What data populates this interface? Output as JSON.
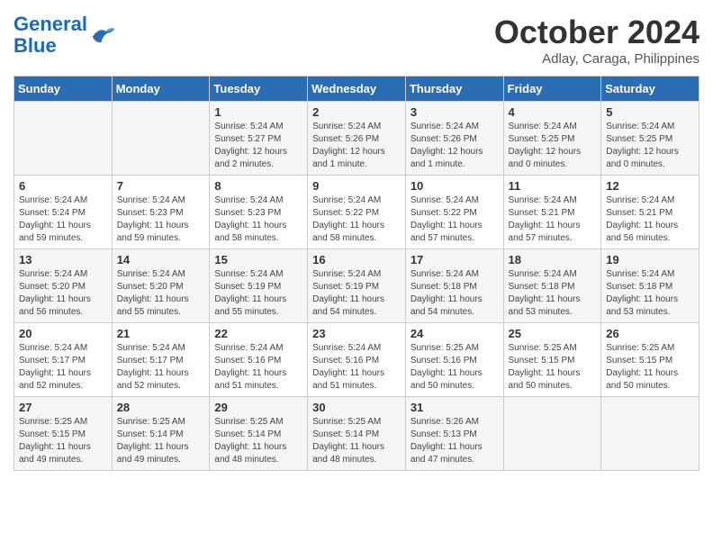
{
  "header": {
    "logo_line1": "General",
    "logo_line2": "Blue",
    "month": "October 2024",
    "location": "Adlay, Caraga, Philippines"
  },
  "days_of_week": [
    "Sunday",
    "Monday",
    "Tuesday",
    "Wednesday",
    "Thursday",
    "Friday",
    "Saturday"
  ],
  "weeks": [
    [
      {
        "day": "",
        "info": ""
      },
      {
        "day": "",
        "info": ""
      },
      {
        "day": "1",
        "info": "Sunrise: 5:24 AM\nSunset: 5:27 PM\nDaylight: 12 hours\nand 2 minutes."
      },
      {
        "day": "2",
        "info": "Sunrise: 5:24 AM\nSunset: 5:26 PM\nDaylight: 12 hours\nand 1 minute."
      },
      {
        "day": "3",
        "info": "Sunrise: 5:24 AM\nSunset: 5:26 PM\nDaylight: 12 hours\nand 1 minute."
      },
      {
        "day": "4",
        "info": "Sunrise: 5:24 AM\nSunset: 5:25 PM\nDaylight: 12 hours\nand 0 minutes."
      },
      {
        "day": "5",
        "info": "Sunrise: 5:24 AM\nSunset: 5:25 PM\nDaylight: 12 hours\nand 0 minutes."
      }
    ],
    [
      {
        "day": "6",
        "info": "Sunrise: 5:24 AM\nSunset: 5:24 PM\nDaylight: 11 hours\nand 59 minutes."
      },
      {
        "day": "7",
        "info": "Sunrise: 5:24 AM\nSunset: 5:23 PM\nDaylight: 11 hours\nand 59 minutes."
      },
      {
        "day": "8",
        "info": "Sunrise: 5:24 AM\nSunset: 5:23 PM\nDaylight: 11 hours\nand 58 minutes."
      },
      {
        "day": "9",
        "info": "Sunrise: 5:24 AM\nSunset: 5:22 PM\nDaylight: 11 hours\nand 58 minutes."
      },
      {
        "day": "10",
        "info": "Sunrise: 5:24 AM\nSunset: 5:22 PM\nDaylight: 11 hours\nand 57 minutes."
      },
      {
        "day": "11",
        "info": "Sunrise: 5:24 AM\nSunset: 5:21 PM\nDaylight: 11 hours\nand 57 minutes."
      },
      {
        "day": "12",
        "info": "Sunrise: 5:24 AM\nSunset: 5:21 PM\nDaylight: 11 hours\nand 56 minutes."
      }
    ],
    [
      {
        "day": "13",
        "info": "Sunrise: 5:24 AM\nSunset: 5:20 PM\nDaylight: 11 hours\nand 56 minutes."
      },
      {
        "day": "14",
        "info": "Sunrise: 5:24 AM\nSunset: 5:20 PM\nDaylight: 11 hours\nand 55 minutes."
      },
      {
        "day": "15",
        "info": "Sunrise: 5:24 AM\nSunset: 5:19 PM\nDaylight: 11 hours\nand 55 minutes."
      },
      {
        "day": "16",
        "info": "Sunrise: 5:24 AM\nSunset: 5:19 PM\nDaylight: 11 hours\nand 54 minutes."
      },
      {
        "day": "17",
        "info": "Sunrise: 5:24 AM\nSunset: 5:18 PM\nDaylight: 11 hours\nand 54 minutes."
      },
      {
        "day": "18",
        "info": "Sunrise: 5:24 AM\nSunset: 5:18 PM\nDaylight: 11 hours\nand 53 minutes."
      },
      {
        "day": "19",
        "info": "Sunrise: 5:24 AM\nSunset: 5:18 PM\nDaylight: 11 hours\nand 53 minutes."
      }
    ],
    [
      {
        "day": "20",
        "info": "Sunrise: 5:24 AM\nSunset: 5:17 PM\nDaylight: 11 hours\nand 52 minutes."
      },
      {
        "day": "21",
        "info": "Sunrise: 5:24 AM\nSunset: 5:17 PM\nDaylight: 11 hours\nand 52 minutes."
      },
      {
        "day": "22",
        "info": "Sunrise: 5:24 AM\nSunset: 5:16 PM\nDaylight: 11 hours\nand 51 minutes."
      },
      {
        "day": "23",
        "info": "Sunrise: 5:24 AM\nSunset: 5:16 PM\nDaylight: 11 hours\nand 51 minutes."
      },
      {
        "day": "24",
        "info": "Sunrise: 5:25 AM\nSunset: 5:16 PM\nDaylight: 11 hours\nand 50 minutes."
      },
      {
        "day": "25",
        "info": "Sunrise: 5:25 AM\nSunset: 5:15 PM\nDaylight: 11 hours\nand 50 minutes."
      },
      {
        "day": "26",
        "info": "Sunrise: 5:25 AM\nSunset: 5:15 PM\nDaylight: 11 hours\nand 50 minutes."
      }
    ],
    [
      {
        "day": "27",
        "info": "Sunrise: 5:25 AM\nSunset: 5:15 PM\nDaylight: 11 hours\nand 49 minutes."
      },
      {
        "day": "28",
        "info": "Sunrise: 5:25 AM\nSunset: 5:14 PM\nDaylight: 11 hours\nand 49 minutes."
      },
      {
        "day": "29",
        "info": "Sunrise: 5:25 AM\nSunset: 5:14 PM\nDaylight: 11 hours\nand 48 minutes."
      },
      {
        "day": "30",
        "info": "Sunrise: 5:25 AM\nSunset: 5:14 PM\nDaylight: 11 hours\nand 48 minutes."
      },
      {
        "day": "31",
        "info": "Sunrise: 5:26 AM\nSunset: 5:13 PM\nDaylight: 11 hours\nand 47 minutes."
      },
      {
        "day": "",
        "info": ""
      },
      {
        "day": "",
        "info": ""
      }
    ]
  ]
}
